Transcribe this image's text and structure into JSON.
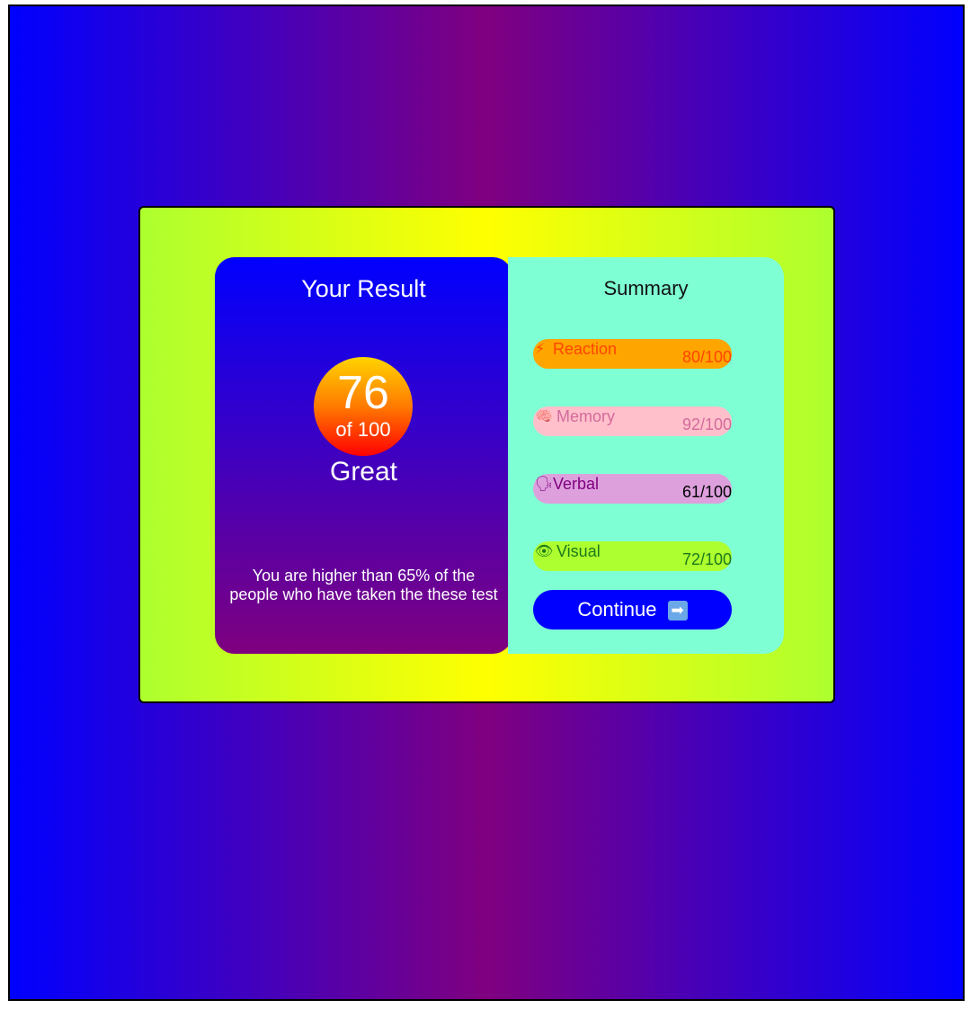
{
  "result": {
    "title": "Your Result",
    "score": "76",
    "score_of": "of 100",
    "rating": "Great",
    "description": "You are higher than 65% of the people who have taken the these test"
  },
  "summary": {
    "title": "Summary",
    "items": [
      {
        "icon": "lightning-icon",
        "glyph": "⚡",
        "label": "Reaction",
        "value": "80/100"
      },
      {
        "icon": "brain-icon",
        "glyph": "🧠",
        "label": "Memory",
        "value": "92/100"
      },
      {
        "icon": "speaking-head-icon",
        "glyph": "🗣",
        "label": "Verbal",
        "value": "61/100"
      },
      {
        "icon": "eye-icon",
        "glyph": "👁",
        "label": "Visual",
        "value": "72/100"
      }
    ],
    "continue_label": "Continue",
    "continue_icon": "right-arrow-icon",
    "continue_glyph": "➡"
  },
  "colors": {
    "background_edge": "#0000ff",
    "background_center": "#80007f",
    "card_edge": "#adff2f",
    "card_center": "#ffff00",
    "summary_bg": "#7fffd4",
    "reaction": "#ffa500",
    "memory": "#ffc0cb",
    "verbal": "#dda0dd",
    "visual": "#adff2f",
    "button": "#0000ff"
  }
}
